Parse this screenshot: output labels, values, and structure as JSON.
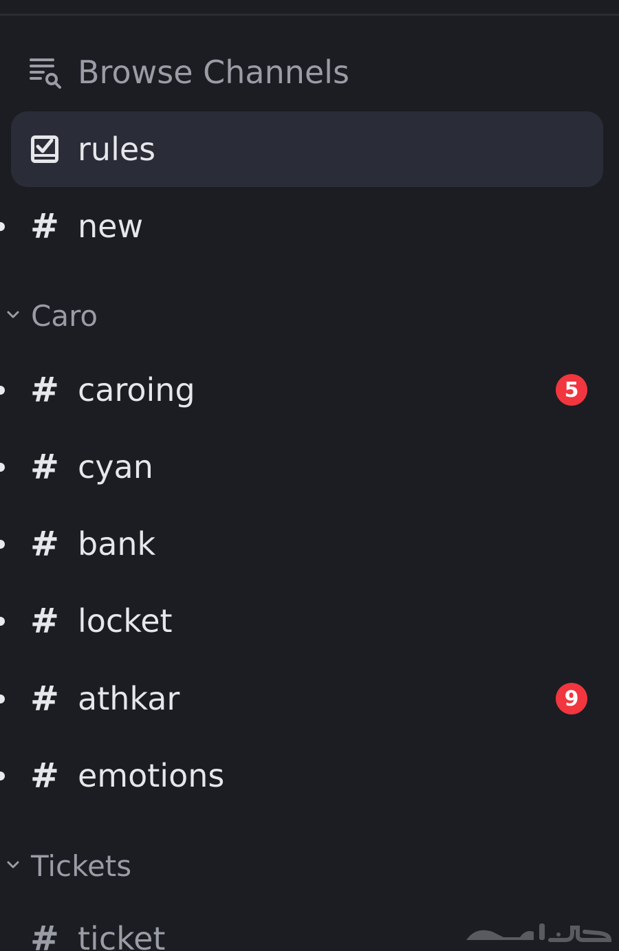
{
  "sidebar": {
    "browse_label": "Browse Channels",
    "top_channels": [
      {
        "name": "rules",
        "icon": "rules-checkbox-icon",
        "selected": true
      },
      {
        "name": "new",
        "icon": "hash-icon",
        "unread": true
      }
    ],
    "categories": [
      {
        "name": "Caro",
        "channels": [
          {
            "name": "caroing",
            "badge": "5"
          },
          {
            "name": "cyan",
            "badge": ""
          },
          {
            "name": "bank",
            "badge": ""
          },
          {
            "name": "locket",
            "badge": ""
          },
          {
            "name": "athkar",
            "badge": "9"
          },
          {
            "name": "emotions",
            "badge": ""
          }
        ]
      },
      {
        "name": "Tickets",
        "channels": [
          {
            "name": "ticket",
            "badge": ""
          }
        ]
      }
    ]
  },
  "hash_glyph": "#",
  "colors": {
    "background": "#1c1d22",
    "selected_row": "#2a2d37",
    "text_primary": "#e6e7ea",
    "text_muted": "#9a9ca6",
    "badge": "#f1363f"
  }
}
